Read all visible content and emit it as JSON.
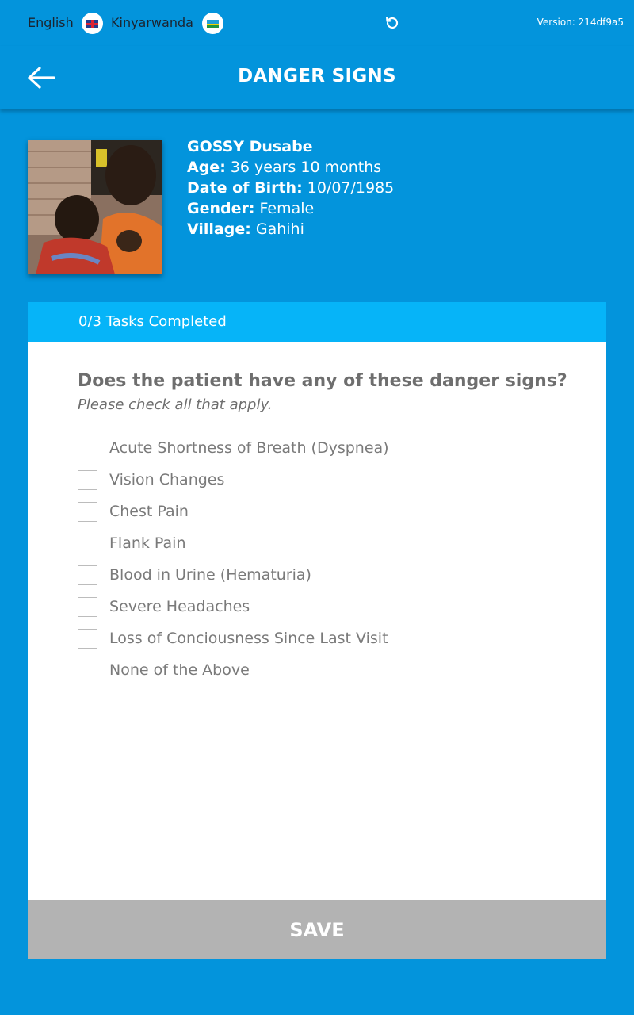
{
  "topbar": {
    "languages": [
      {
        "label": "English",
        "flag": "uk-flag-icon"
      },
      {
        "label": "Kinyarwanda",
        "flag": "rwanda-flag-icon"
      }
    ],
    "refresh_icon": "refresh-icon",
    "version": "Version: 214df9a5"
  },
  "header": {
    "back_icon": "arrow-left-icon",
    "title": "DANGER SIGNS"
  },
  "patient": {
    "name": "GOSSY Dusabe",
    "age_label": "Age:",
    "age": "36 years 10 months",
    "dob_label": "Date of Birth:",
    "dob": "10/07/1985",
    "gender_label": "Gender:",
    "gender": "Female",
    "village_label": "Village:",
    "village": "Gahihi"
  },
  "task": {
    "progress": "0/3 Tasks Completed",
    "question": "Does the patient have any of these danger signs?",
    "instruction": "Please check all that apply.",
    "options": [
      "Acute Shortness of Breath (Dyspnea)",
      "Vision Changes",
      "Chest Pain",
      "Flank Pain",
      "Blood in Urine (Hematuria)",
      "Severe Headaches",
      "Loss of Conciousness Since Last Visit",
      "None of the Above"
    ]
  },
  "save_label": "SAVE",
  "colors": {
    "background": "#0394dc",
    "card_header": "#06b4f8",
    "save_button": "#b3b3b3",
    "text_gray": "#6e6e6e"
  }
}
